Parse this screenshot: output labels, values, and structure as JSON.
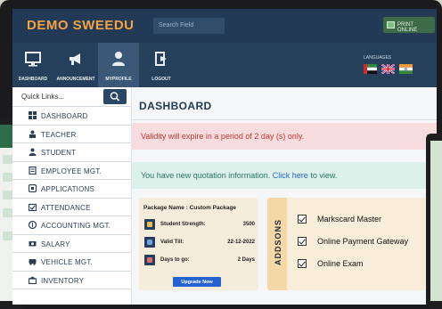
{
  "header": {
    "brand": "DEMO SWEEDU",
    "search_placeholder": "Search Field",
    "right_button_label": "PRINT ONLINE"
  },
  "nav": {
    "items": [
      {
        "label": "DASHBOARD",
        "icon": "monitor-icon"
      },
      {
        "label": "ANNOUNCEMENT",
        "icon": "megaphone-icon"
      },
      {
        "label": "MYPROFILE",
        "icon": "user-icon"
      },
      {
        "label": "LOGOUT",
        "icon": "logout-icon"
      }
    ],
    "active_index": 2,
    "languages_label": "LANGUAGES",
    "flags": [
      "uae-flag-icon",
      "uk-flag-icon",
      "india-flag-icon"
    ]
  },
  "sidebar": {
    "quick_links_label": "Quick Links...",
    "items": [
      {
        "label": "DASHBOARD",
        "icon": "grid-icon"
      },
      {
        "label": "TEACHER",
        "icon": "teacher-icon"
      },
      {
        "label": "STUDENT",
        "icon": "student-icon"
      },
      {
        "label": "EMPLOYEE MGT.",
        "icon": "employee-icon"
      },
      {
        "label": "APPLICATIONS",
        "icon": "applications-icon"
      },
      {
        "label": "ATTENDANCE",
        "icon": "attendance-icon"
      },
      {
        "label": "ACCOUNTING MGT.",
        "icon": "accounting-icon"
      },
      {
        "label": "SALARY",
        "icon": "salary-icon"
      },
      {
        "label": "VEHICLE MGT.",
        "icon": "vehicle-icon"
      },
      {
        "label": "INVENTORY",
        "icon": "inventory-icon"
      }
    ]
  },
  "main": {
    "title": "DASHBOARD",
    "validity_alert": "Validity will expire in a period of 2 day (s) only.",
    "quotation_prefix": "You have new quotation information.",
    "quotation_link": "Click here",
    "quotation_suffix": "to view.",
    "close_glyph": "x"
  },
  "package": {
    "name": "Package Name : Custom Package",
    "rows": [
      {
        "label": "Student Strength:",
        "value": "3500",
        "icon": "student-strength-icon",
        "color": "#e8c14a"
      },
      {
        "label": "Valid Till:",
        "value": "22-12-2022",
        "icon": "calendar-icon",
        "color": "#6aa0e0"
      },
      {
        "label": "Days to go:",
        "value": "2 Days",
        "icon": "countdown-icon",
        "color": "#e06a6a"
      }
    ],
    "upgrade_label": "Upgrade Now"
  },
  "addons": {
    "title": "ADDSONS",
    "items": [
      {
        "label": "Markscard Master",
        "checked": true
      },
      {
        "label": "Online Payment Gateway",
        "checked": true
      },
      {
        "label": "Online Exam",
        "checked": true
      }
    ]
  },
  "colors": {
    "header_bg": "#223a56",
    "brand": "#f4a340",
    "alert_red": "#c0392b",
    "alert_green": "#2a7563",
    "link": "#2a63c7",
    "upgrade_button": "#2462d4"
  }
}
